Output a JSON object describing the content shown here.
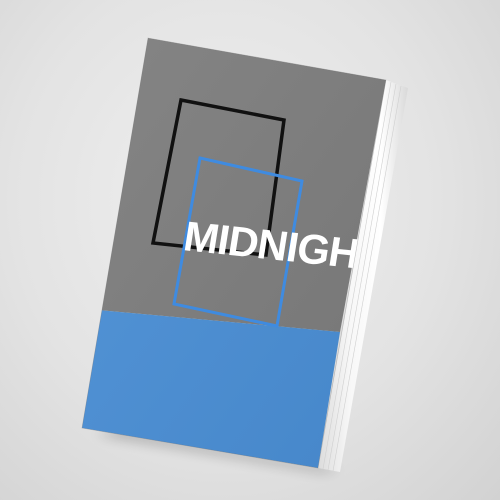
{
  "book": {
    "title": "MIDNIGHT"
  },
  "colors": {
    "background": "#e4e4e4",
    "cover_gray": "#7d7d7d",
    "cover_blue": "#4a8fd6",
    "outline_black": "#111111",
    "outline_blue": "#3f8be0",
    "title_white": "#ffffff",
    "pages": "#f4f4f4"
  }
}
